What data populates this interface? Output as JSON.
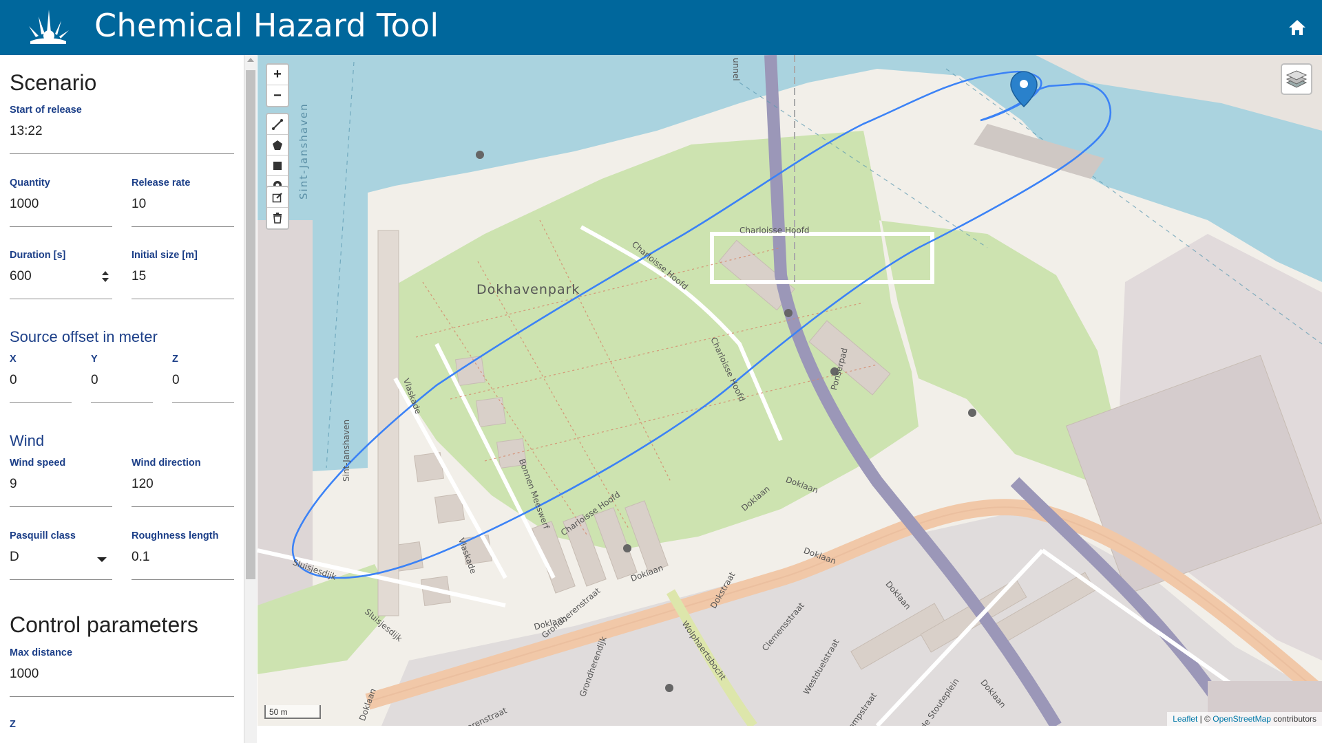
{
  "header": {
    "title": "Chemical Hazard Tool",
    "logo_icon": "hazard-logo-icon",
    "home_icon": "home-icon",
    "background": "#00679c"
  },
  "scenario": {
    "title": "Scenario",
    "start_label": "Start of release",
    "start_value": "13:22",
    "quantity_label": "Quantity",
    "quantity_value": "1000",
    "release_rate_label": "Release rate",
    "release_rate_value": "10",
    "duration_label": "Duration [s]",
    "duration_value": "600",
    "initial_size_label": "Initial size [m]",
    "initial_size_value": "15"
  },
  "source_offset": {
    "title": "Source offset in meter",
    "x_label": "X",
    "x_value": "0",
    "y_label": "Y",
    "y_value": "0",
    "z_label": "Z",
    "z_value": "0"
  },
  "wind": {
    "title": "Wind",
    "speed_label": "Wind speed",
    "speed_value": "9",
    "direction_label": "Wind direction",
    "direction_value": "120",
    "pasquill_label": "Pasquill class",
    "pasquill_value": "D",
    "roughness_label": "Roughness length",
    "roughness_value": "0.1"
  },
  "control": {
    "title": "Control parameters",
    "max_distance_label": "Max distance",
    "max_distance_value": "1000",
    "z_label": "Z"
  },
  "map": {
    "zoom_in": "+",
    "zoom_out": "−",
    "scale_label": "50 m",
    "attribution_leaflet": "Leaflet",
    "attribution_sep": " | © ",
    "attribution_osm": "OpenStreetMap",
    "attribution_suffix": " contributors",
    "plume_color": "#3b82f6",
    "water_color": "#aad3df",
    "park_color": "#d5e8b8",
    "labels": {
      "park": "Dokhavenpark",
      "harbour": "Sint-Janshaven",
      "street_janshaven": "Sint-Janshaven",
      "vlaskade": "Vlaskade",
      "vlaskade2": "Vlaskade",
      "charloisse_hoofd1": "Charloisse Hoofd",
      "charloisse_hoofd2": "Charloisse Hoofd",
      "charloisse_hoofd3": "Charloisse Hoofd",
      "charloisse_hoofd4": "Charloisse Hoofd",
      "bonnen": "Bonnen Meeswerf",
      "sluisjesdijk": "Sluisjesdijk",
      "sluisjesdijk2": "Sluisjesdijk",
      "doklaan1": "Doklaan",
      "doklaan2": "Doklaan",
      "doklaan3": "Doklaan",
      "doklaan4": "Doklaan",
      "doklaan5": "Doklaan",
      "doklaan6": "Doklaan",
      "doklaan7": "Doklaan",
      "doklaan8": "Doklaan",
      "ponserpad": "Ponserpad",
      "grondherenstraat": "Grondherenstraat",
      "grondherendijk": "Grondherendijk",
      "wolphaertsbocht": "Wolphaertsbocht",
      "dokstraat": "Dokstraat",
      "clemensstraat": "Clemensstraat",
      "westduelstraat": "Westduelstraat",
      "ompstraat": "ompstraat",
      "stouteplein": "de Stouteplein",
      "herenstraat": "herenstraat",
      "tunnel": "unnel"
    }
  }
}
